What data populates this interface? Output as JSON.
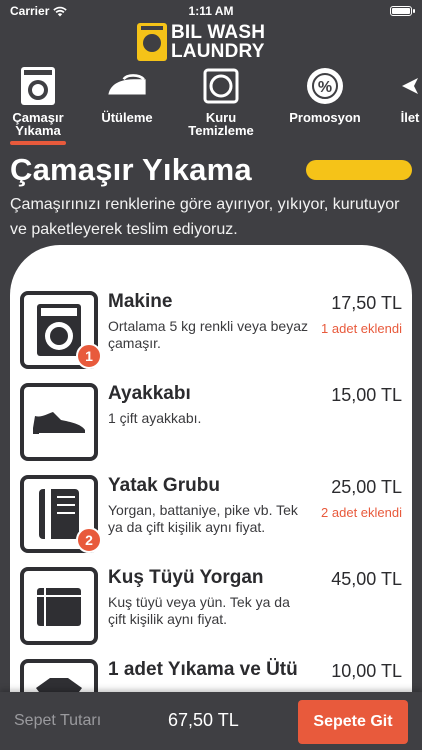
{
  "status_bar": {
    "carrier": "Carrier",
    "time": "1:11 AM"
  },
  "logo": {
    "line1": "BIL WASH",
    "line2": "LAUNDRY"
  },
  "tabs": [
    {
      "label": "Çamaşır\nYıkama",
      "icon": "washing-machine-icon",
      "selected": true
    },
    {
      "label": "Ütüleme",
      "icon": "iron-icon",
      "selected": false
    },
    {
      "label": "Kuru\nTemizleme",
      "icon": "dry-clean-icon",
      "selected": false
    },
    {
      "label": "Promosyon",
      "icon": "percent-badge-icon",
      "selected": false
    },
    {
      "label": "İlet",
      "icon": "send-icon",
      "selected": false
    }
  ],
  "section": {
    "title": "Çamaşır Yıkama",
    "description": "Çamaşırınızı renklerine göre ayırıyor, yıkıyor, kurutuyor ve paketleyerek teslim ediyoruz."
  },
  "items": [
    {
      "name": "Makine",
      "description": "Ortalama 5 kg renkli veya beyaz çamaşır.",
      "price": "17,50 TL",
      "added": "1 adet eklendi",
      "badge": "1",
      "icon": "washing-machine-icon"
    },
    {
      "name": "Ayakkabı",
      "description": "1 çift ayakkabı.",
      "price": "15,00 TL",
      "added": "",
      "badge": "",
      "icon": "shoe-icon"
    },
    {
      "name": "Yatak Grubu",
      "description": "Yorgan, battaniye, pike vb. Tek ya da çift kişilik aynı fiyat.",
      "price": "25,00 TL",
      "added": "2 adet eklendi",
      "badge": "2",
      "icon": "blanket-icon"
    },
    {
      "name": "Kuş Tüyü Yorgan",
      "description": "Kuş tüyü veya yün. Tek ya da çift kişilik aynı fiyat.",
      "price": "45,00 TL",
      "added": "",
      "badge": "",
      "icon": "quilt-icon"
    },
    {
      "name": "1 adet Yıkama ve Ütü",
      "description": "",
      "price": "10,00 TL",
      "added": "",
      "badge": "",
      "icon": "tshirt-icon"
    }
  ],
  "footer": {
    "total_label": "Sepet Tutarı",
    "total_value": "67,50 TL",
    "cart_button": "Sepete Git"
  },
  "colors": {
    "background": "#3f3f43",
    "accent_yellow": "#f5c318",
    "accent_red": "#e85a3c"
  }
}
